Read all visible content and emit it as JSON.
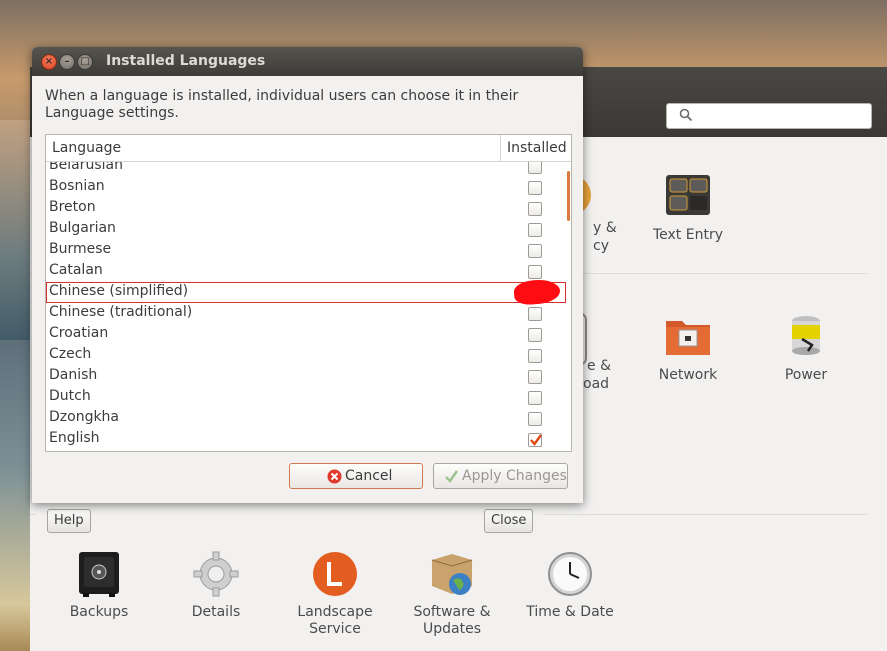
{
  "dialog": {
    "title": "Installed Languages",
    "description": "When a language is installed, individual users can choose it in their Language settings.",
    "columns": {
      "language": "Language",
      "installed": "Installed"
    },
    "rows": [
      {
        "name": "Belarusian",
        "installed": false
      },
      {
        "name": "Bosnian",
        "installed": false
      },
      {
        "name": "Breton",
        "installed": false
      },
      {
        "name": "Bulgarian",
        "installed": false
      },
      {
        "name": "Burmese",
        "installed": false
      },
      {
        "name": "Catalan",
        "installed": false
      },
      {
        "name": "Chinese (simplified)",
        "installed": false,
        "highlighted": true
      },
      {
        "name": "Chinese (traditional)",
        "installed": false
      },
      {
        "name": "Croatian",
        "installed": false
      },
      {
        "name": "Czech",
        "installed": false
      },
      {
        "name": "Danish",
        "installed": false
      },
      {
        "name": "Dutch",
        "installed": false
      },
      {
        "name": "Dzongkha",
        "installed": false
      },
      {
        "name": "English",
        "installed": true
      }
    ],
    "cancel_label": "Cancel",
    "apply_label": "Apply Changes"
  },
  "settings_panel": {
    "help_label": "Help",
    "close_label": "Close",
    "items_top": [
      {
        "label": "Text Entry",
        "icon": "keyboard-icon"
      }
    ],
    "partial_labels": [
      "y &",
      "cy",
      "e &",
      "oad"
    ],
    "items_mid": [
      {
        "label": "Network",
        "icon": "network-folder-icon"
      },
      {
        "label": "Power",
        "icon": "battery-icon"
      }
    ],
    "items_system": [
      {
        "label": "Backups",
        "icon": "safe-icon"
      },
      {
        "label": "Details",
        "icon": "gear-icon"
      },
      {
        "label": "Landscape Service",
        "icon": "landscape-icon"
      },
      {
        "label": "Software & Updates",
        "icon": "package-globe-icon"
      },
      {
        "label": "Time & Date",
        "icon": "clock-icon"
      }
    ]
  },
  "colors": {
    "accent": "#dd4814",
    "highlight_border": "#d9302a",
    "check": "#dd4814"
  }
}
